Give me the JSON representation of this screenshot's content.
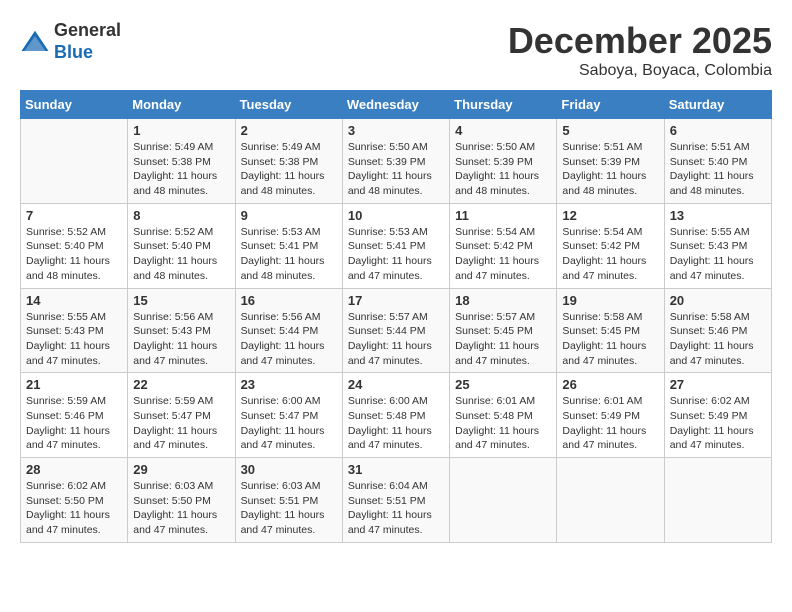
{
  "logo": {
    "general": "General",
    "blue": "Blue"
  },
  "header": {
    "month": "December 2025",
    "location": "Saboya, Boyaca, Colombia"
  },
  "weekdays": [
    "Sunday",
    "Monday",
    "Tuesday",
    "Wednesday",
    "Thursday",
    "Friday",
    "Saturday"
  ],
  "weeks": [
    [
      {
        "day": "",
        "info": ""
      },
      {
        "day": "1",
        "info": "Sunrise: 5:49 AM\nSunset: 5:38 PM\nDaylight: 11 hours\nand 48 minutes."
      },
      {
        "day": "2",
        "info": "Sunrise: 5:49 AM\nSunset: 5:38 PM\nDaylight: 11 hours\nand 48 minutes."
      },
      {
        "day": "3",
        "info": "Sunrise: 5:50 AM\nSunset: 5:39 PM\nDaylight: 11 hours\nand 48 minutes."
      },
      {
        "day": "4",
        "info": "Sunrise: 5:50 AM\nSunset: 5:39 PM\nDaylight: 11 hours\nand 48 minutes."
      },
      {
        "day": "5",
        "info": "Sunrise: 5:51 AM\nSunset: 5:39 PM\nDaylight: 11 hours\nand 48 minutes."
      },
      {
        "day": "6",
        "info": "Sunrise: 5:51 AM\nSunset: 5:40 PM\nDaylight: 11 hours\nand 48 minutes."
      }
    ],
    [
      {
        "day": "7",
        "info": "Sunrise: 5:52 AM\nSunset: 5:40 PM\nDaylight: 11 hours\nand 48 minutes."
      },
      {
        "day": "8",
        "info": "Sunrise: 5:52 AM\nSunset: 5:40 PM\nDaylight: 11 hours\nand 48 minutes."
      },
      {
        "day": "9",
        "info": "Sunrise: 5:53 AM\nSunset: 5:41 PM\nDaylight: 11 hours\nand 48 minutes."
      },
      {
        "day": "10",
        "info": "Sunrise: 5:53 AM\nSunset: 5:41 PM\nDaylight: 11 hours\nand 47 minutes."
      },
      {
        "day": "11",
        "info": "Sunrise: 5:54 AM\nSunset: 5:42 PM\nDaylight: 11 hours\nand 47 minutes."
      },
      {
        "day": "12",
        "info": "Sunrise: 5:54 AM\nSunset: 5:42 PM\nDaylight: 11 hours\nand 47 minutes."
      },
      {
        "day": "13",
        "info": "Sunrise: 5:55 AM\nSunset: 5:43 PM\nDaylight: 11 hours\nand 47 minutes."
      }
    ],
    [
      {
        "day": "14",
        "info": "Sunrise: 5:55 AM\nSunset: 5:43 PM\nDaylight: 11 hours\nand 47 minutes."
      },
      {
        "day": "15",
        "info": "Sunrise: 5:56 AM\nSunset: 5:43 PM\nDaylight: 11 hours\nand 47 minutes."
      },
      {
        "day": "16",
        "info": "Sunrise: 5:56 AM\nSunset: 5:44 PM\nDaylight: 11 hours\nand 47 minutes."
      },
      {
        "day": "17",
        "info": "Sunrise: 5:57 AM\nSunset: 5:44 PM\nDaylight: 11 hours\nand 47 minutes."
      },
      {
        "day": "18",
        "info": "Sunrise: 5:57 AM\nSunset: 5:45 PM\nDaylight: 11 hours\nand 47 minutes."
      },
      {
        "day": "19",
        "info": "Sunrise: 5:58 AM\nSunset: 5:45 PM\nDaylight: 11 hours\nand 47 minutes."
      },
      {
        "day": "20",
        "info": "Sunrise: 5:58 AM\nSunset: 5:46 PM\nDaylight: 11 hours\nand 47 minutes."
      }
    ],
    [
      {
        "day": "21",
        "info": "Sunrise: 5:59 AM\nSunset: 5:46 PM\nDaylight: 11 hours\nand 47 minutes."
      },
      {
        "day": "22",
        "info": "Sunrise: 5:59 AM\nSunset: 5:47 PM\nDaylight: 11 hours\nand 47 minutes."
      },
      {
        "day": "23",
        "info": "Sunrise: 6:00 AM\nSunset: 5:47 PM\nDaylight: 11 hours\nand 47 minutes."
      },
      {
        "day": "24",
        "info": "Sunrise: 6:00 AM\nSunset: 5:48 PM\nDaylight: 11 hours\nand 47 minutes."
      },
      {
        "day": "25",
        "info": "Sunrise: 6:01 AM\nSunset: 5:48 PM\nDaylight: 11 hours\nand 47 minutes."
      },
      {
        "day": "26",
        "info": "Sunrise: 6:01 AM\nSunset: 5:49 PM\nDaylight: 11 hours\nand 47 minutes."
      },
      {
        "day": "27",
        "info": "Sunrise: 6:02 AM\nSunset: 5:49 PM\nDaylight: 11 hours\nand 47 minutes."
      }
    ],
    [
      {
        "day": "28",
        "info": "Sunrise: 6:02 AM\nSunset: 5:50 PM\nDaylight: 11 hours\nand 47 minutes."
      },
      {
        "day": "29",
        "info": "Sunrise: 6:03 AM\nSunset: 5:50 PM\nDaylight: 11 hours\nand 47 minutes."
      },
      {
        "day": "30",
        "info": "Sunrise: 6:03 AM\nSunset: 5:51 PM\nDaylight: 11 hours\nand 47 minutes."
      },
      {
        "day": "31",
        "info": "Sunrise: 6:04 AM\nSunset: 5:51 PM\nDaylight: 11 hours\nand 47 minutes."
      },
      {
        "day": "",
        "info": ""
      },
      {
        "day": "",
        "info": ""
      },
      {
        "day": "",
        "info": ""
      }
    ]
  ]
}
